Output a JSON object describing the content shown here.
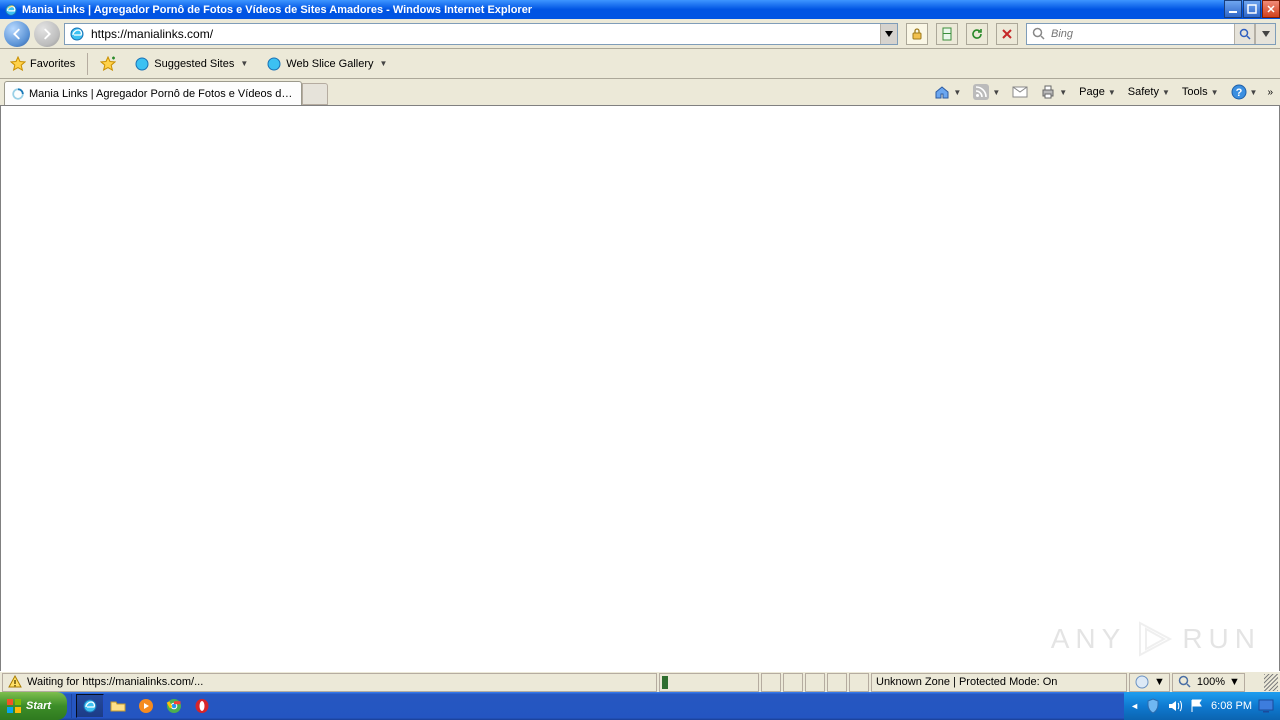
{
  "window": {
    "title": "Mania Links | Agregador Pornô de Fotos e Vídeos de Sites Amadores - Windows Internet Explorer"
  },
  "nav": {
    "url": "https://manialinks.com/",
    "search_placeholder": "Bing"
  },
  "favbar": {
    "favorites": "Favorites",
    "suggested": "Suggested Sites",
    "webslice": "Web Slice Gallery"
  },
  "tab": {
    "title": "Mania Links | Agregador Pornô de Fotos e Vídeos de S..."
  },
  "cmdbar": {
    "page": "Page",
    "safety": "Safety",
    "tools": "Tools"
  },
  "status": {
    "message": "Waiting for https://manialinks.com/...",
    "zone": "Unknown Zone | Protected Mode: On",
    "zoom": "100%"
  },
  "taskbar": {
    "start": "Start",
    "clock": "6:08 PM"
  },
  "watermark": {
    "left": "ANY",
    "right": "RUN"
  }
}
